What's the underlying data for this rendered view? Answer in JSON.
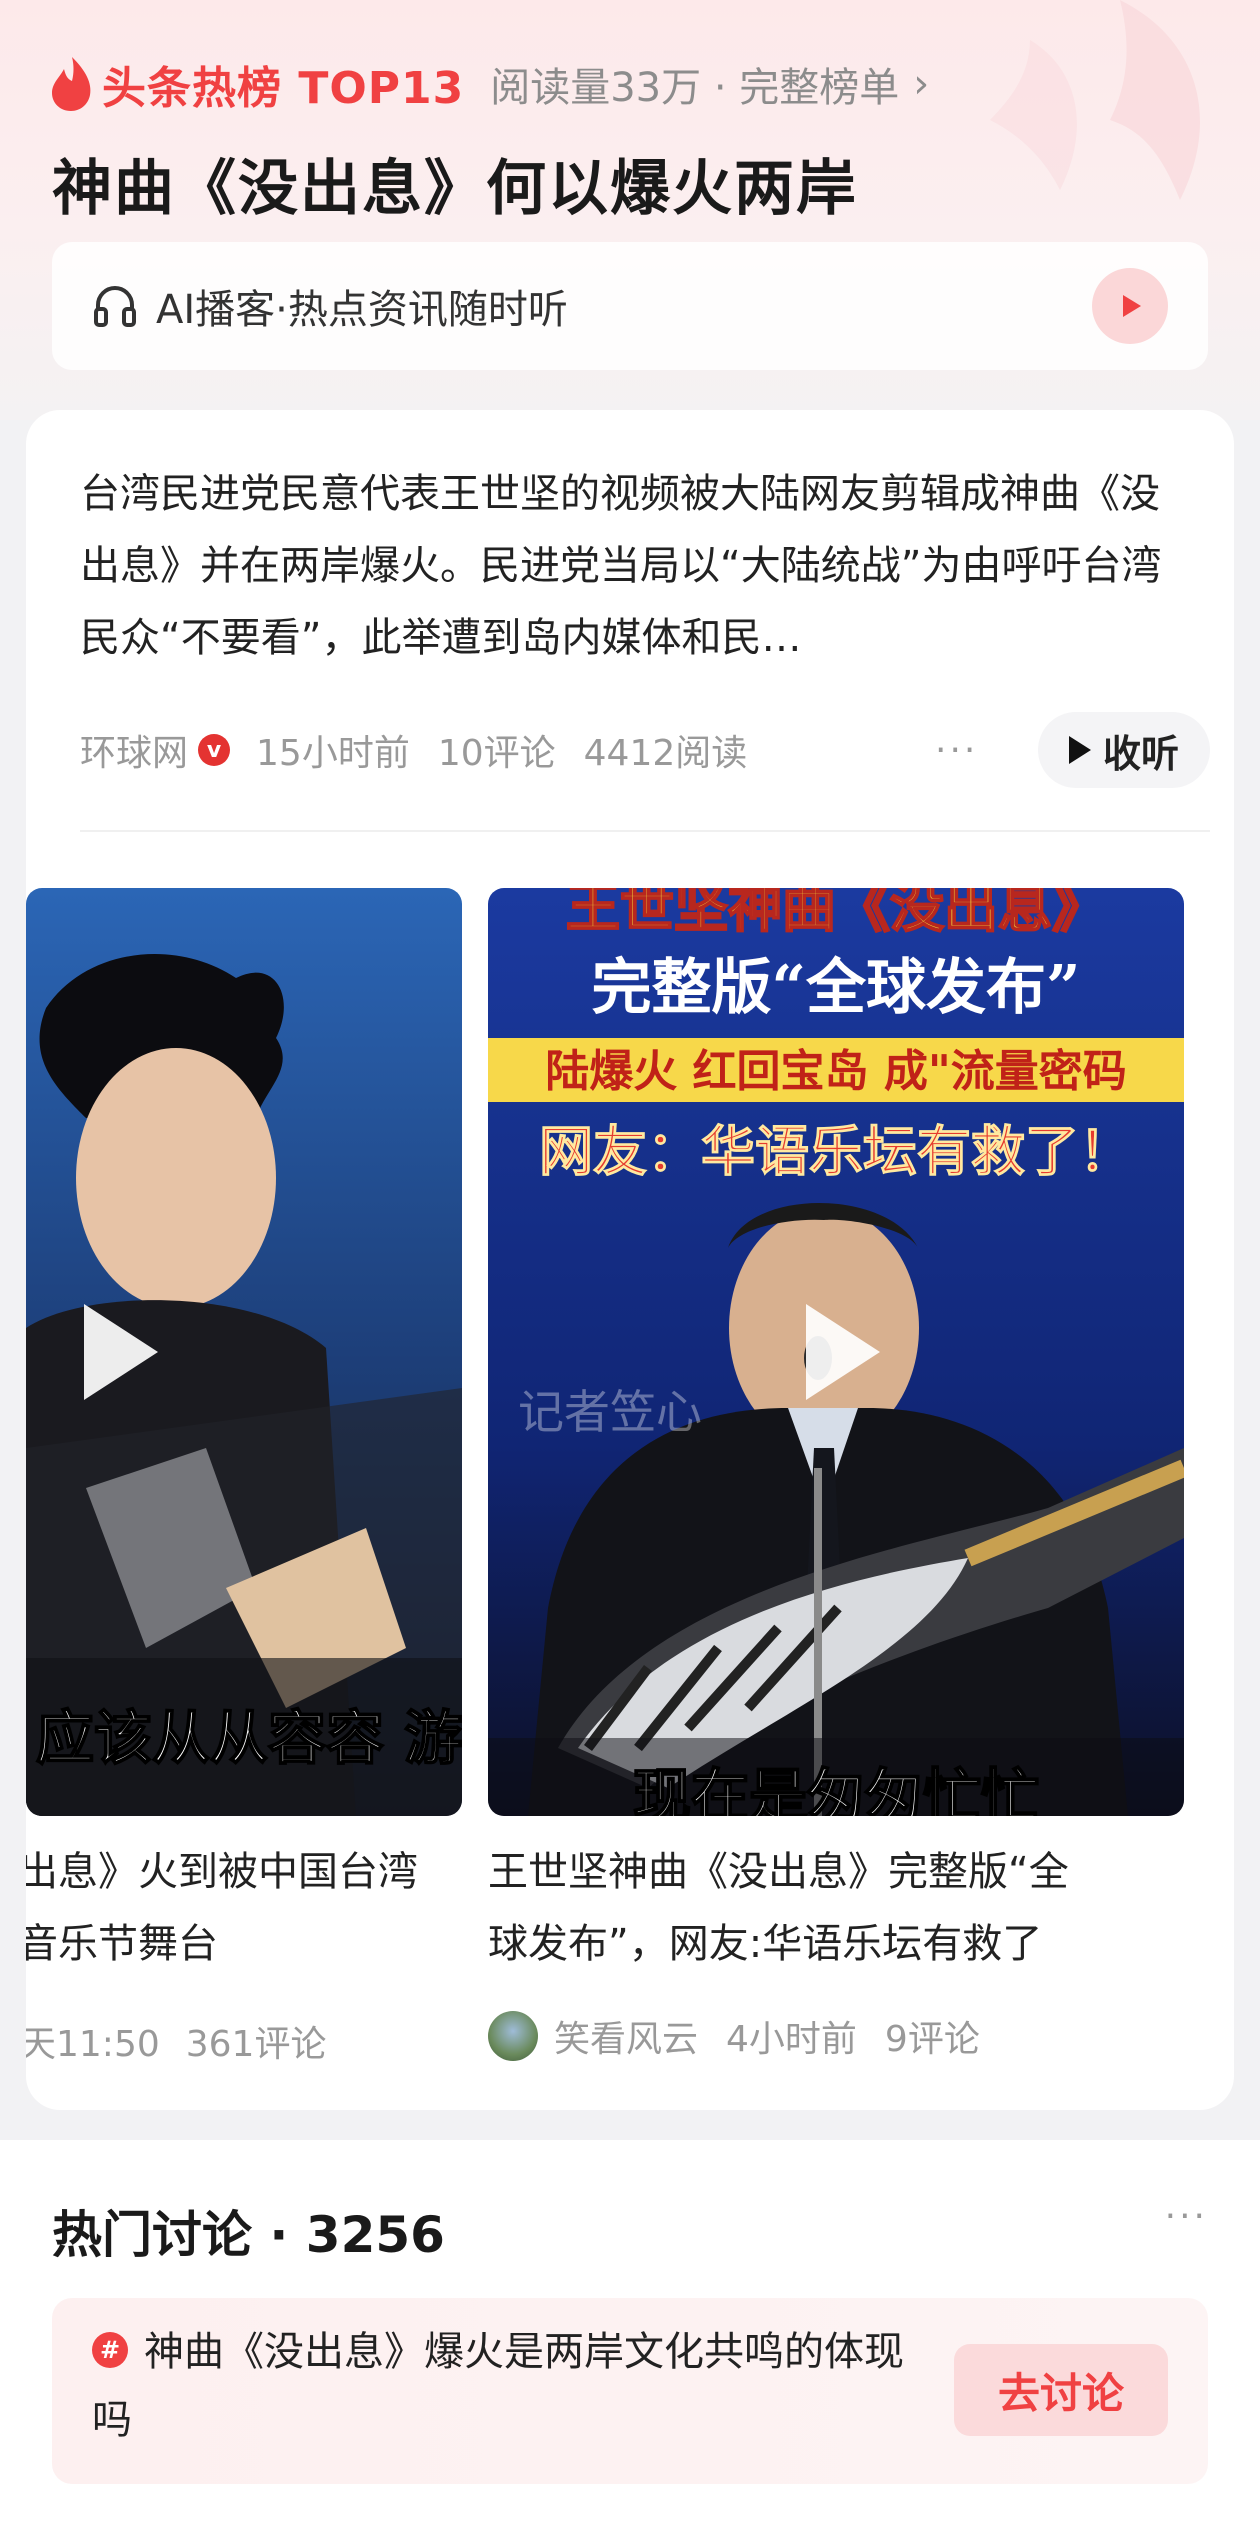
{
  "header": {
    "hot_label": "头条热榜 TOP13",
    "hot_meta": "阅读量33万 · 完整榜单",
    "title": "神曲《没出息》何以爆火两岸"
  },
  "podcast": {
    "label": "AI播客·热点资讯随时听"
  },
  "article": {
    "summary": "台湾民进党民意代表王世坚的视频被大陆网友剪辑成神曲《没出息》并在两岸爆火。民进党当局以“大陆统战”为由呼吁台湾民众“不要看”，此举遭到岛内媒体和民…",
    "source": "环球网",
    "time": "15小时前",
    "comments": "10评论",
    "reads": "4412阅读",
    "more": "···",
    "listen_label": "收听"
  },
  "videos": [
    {
      "title_line1": "出息》火到被中国台湾",
      "title_line2": "音乐节舞台",
      "meta_time": "天11:50",
      "meta_comments": "361评论",
      "caption": "应该从从容容 游"
    },
    {
      "title_line1": "王世坚神曲《没出息》完整版“全",
      "title_line2": "球发布”，网友:华语乐坛有救了",
      "author": "笑看风云",
      "meta_time": "4小时前",
      "meta_comments": "9评论",
      "caption_top": "王世坚神曲《没出息》",
      "caption_1": "完整版“全球发布”",
      "caption_2": "陆爆火 红回宝岛 成\"流量密码",
      "caption_3": "网友：华语乐坛有救了！",
      "caption_bottom": "现在是匆匆忙忙",
      "watermark": "记者笠心"
    }
  ],
  "discussion": {
    "title": "热门讨论 · 3256",
    "more": "···",
    "topic": "神曲《没出息》爆火是两岸文化共鸣的体现吗",
    "button": "去讨论"
  },
  "colors": {
    "accent": "#f04142",
    "button_bg": "#fbdadb"
  }
}
